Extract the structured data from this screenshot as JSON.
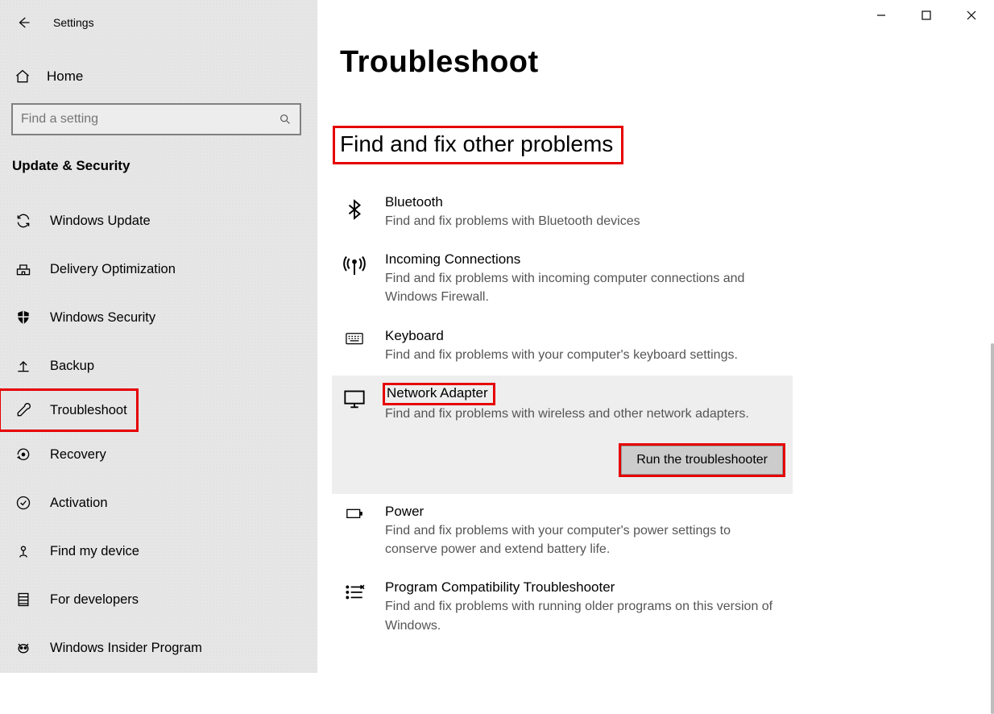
{
  "window": {
    "app_title": "Settings",
    "minimize_glyph": "—",
    "maximize_glyph": "▢",
    "close_glyph": "✕"
  },
  "sidebar": {
    "home_label": "Home",
    "search_placeholder": "Find a setting",
    "section_title": "Update & Security",
    "items": [
      {
        "id": "windows-update",
        "label": "Windows Update"
      },
      {
        "id": "delivery-optimization",
        "label": "Delivery Optimization"
      },
      {
        "id": "windows-security",
        "label": "Windows Security"
      },
      {
        "id": "backup",
        "label": "Backup"
      },
      {
        "id": "troubleshoot",
        "label": "Troubleshoot",
        "highlighted": true
      },
      {
        "id": "recovery",
        "label": "Recovery"
      },
      {
        "id": "activation",
        "label": "Activation"
      },
      {
        "id": "find-my-device",
        "label": "Find my device"
      },
      {
        "id": "for-developers",
        "label": "For developers"
      },
      {
        "id": "windows-insider",
        "label": "Windows Insider Program"
      }
    ]
  },
  "main": {
    "page_title": "Troubleshoot",
    "truncated_prev_line": "",
    "section_header": "Find and fix other problems",
    "run_button_label": "Run the troubleshooter",
    "items": [
      {
        "id": "bluetooth",
        "name": "Bluetooth",
        "desc": "Find and fix problems with Bluetooth devices"
      },
      {
        "id": "incoming-connections",
        "name": "Incoming Connections",
        "desc": "Find and fix problems with incoming computer connections and Windows Firewall."
      },
      {
        "id": "keyboard",
        "name": "Keyboard",
        "desc": "Find and fix problems with your computer's keyboard settings."
      },
      {
        "id": "network-adapter",
        "name": "Network Adapter",
        "desc": "Find and fix problems with wireless and other network adapters.",
        "selected": true,
        "highlighted": true
      },
      {
        "id": "power",
        "name": "Power",
        "desc": "Find and fix problems with your computer's power settings to conserve power and extend battery life."
      },
      {
        "id": "program-compat",
        "name": "Program Compatibility Troubleshooter",
        "desc": "Find and fix problems with running older programs on this version of Windows."
      }
    ]
  }
}
